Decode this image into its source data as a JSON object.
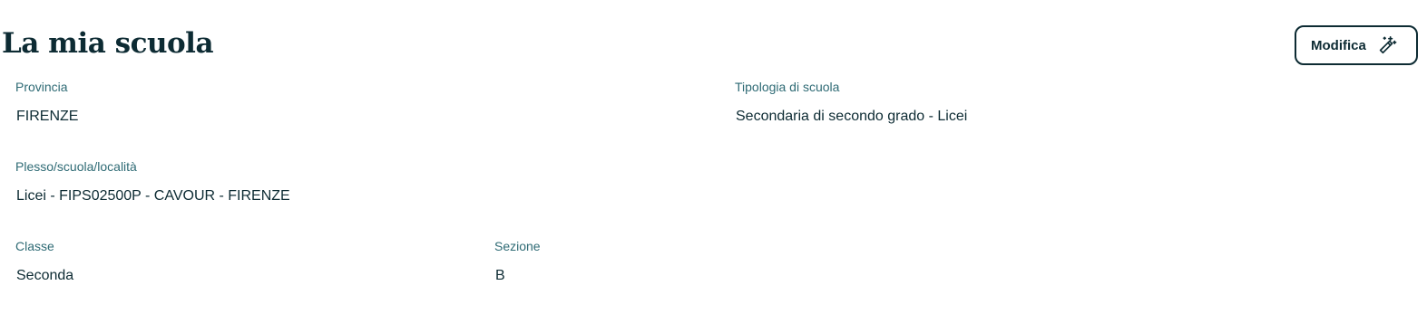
{
  "header": {
    "title": "La mia scuola",
    "edit_label": "Modifica",
    "edit_icon": "magic-wand-icon"
  },
  "fields": {
    "provincia": {
      "label": "Provincia",
      "value": "FIRENZE"
    },
    "tipologia": {
      "label": "Tipologia di scuola",
      "value": "Secondaria di secondo grado - Licei"
    },
    "plesso": {
      "label": "Plesso/scuola/località",
      "value": "Licei - FIPS02500P - CAVOUR - FIRENZE"
    },
    "classe": {
      "label": "Classe",
      "value": "Seconda"
    },
    "sezione": {
      "label": "Sezione",
      "value": "B"
    }
  },
  "colors": {
    "text": "#0d2b33",
    "label": "#2f6b75",
    "button_border": "#0d2b33"
  }
}
